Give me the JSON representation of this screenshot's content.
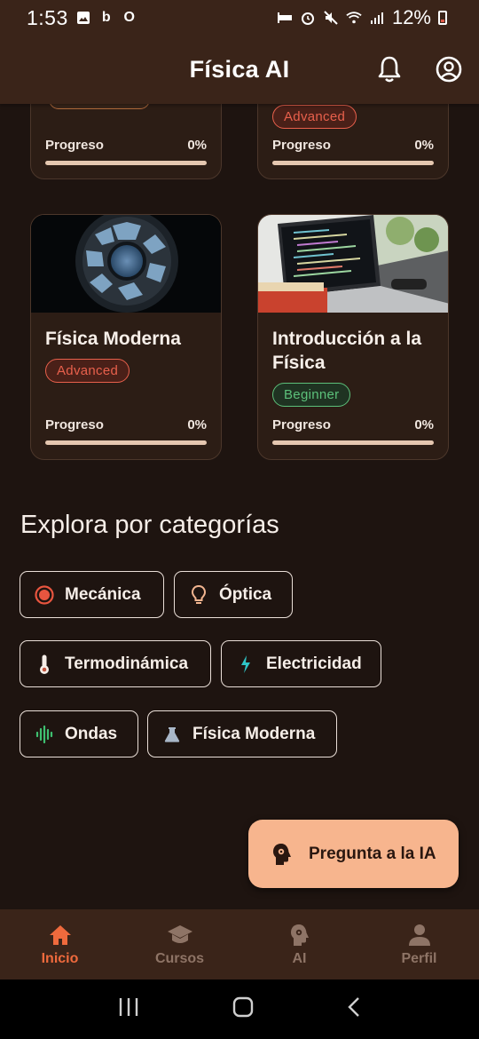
{
  "status_bar": {
    "time": "1:53",
    "battery": "12%"
  },
  "app_bar": {
    "title": "Física AI"
  },
  "courses": [
    {
      "title": "",
      "level": "",
      "progress_label": "Progreso",
      "progress_value": "0%",
      "progress_fraction": 0
    },
    {
      "title": "",
      "level": "Advanced",
      "progress_label": "Progreso",
      "progress_value": "0%",
      "progress_fraction": 0
    },
    {
      "title": "Física Moderna",
      "level": "Advanced",
      "progress_label": "Progreso",
      "progress_value": "0%",
      "progress_fraction": 0
    },
    {
      "title": "Introducción a la Física",
      "level": "Beginner",
      "progress_label": "Progreso",
      "progress_value": "0%",
      "progress_fraction": 0
    }
  ],
  "categories": {
    "title": "Explora por categorías",
    "items": [
      {
        "label": "Mecánica",
        "icon": "target-icon"
      },
      {
        "label": "Óptica",
        "icon": "lightbulb-icon"
      },
      {
        "label": "Termodinámica",
        "icon": "thermometer-icon"
      },
      {
        "label": "Electricidad",
        "icon": "bolt-icon"
      },
      {
        "label": "Ondas",
        "icon": "waveform-icon"
      },
      {
        "label": "Física Moderna",
        "icon": "flask-icon"
      }
    ]
  },
  "fab": {
    "label": "Pregunta a la IA",
    "icon": "brain-head-icon"
  },
  "bottom_nav": {
    "items": [
      {
        "label": "Inicio",
        "icon": "home-icon",
        "active": true
      },
      {
        "label": "Cursos",
        "icon": "graduation-cap-icon",
        "active": false
      },
      {
        "label": "AI",
        "icon": "brain-head-icon",
        "active": false
      },
      {
        "label": "Perfil",
        "icon": "person-icon",
        "active": false
      }
    ]
  },
  "colors": {
    "background": "#1e1410",
    "bar": "#3a2419",
    "card": "#2c1d15",
    "accent": "#ef6a3d",
    "advanced": "#e8604c",
    "beginner": "#5cc07a",
    "fab": "#f7b58e"
  }
}
